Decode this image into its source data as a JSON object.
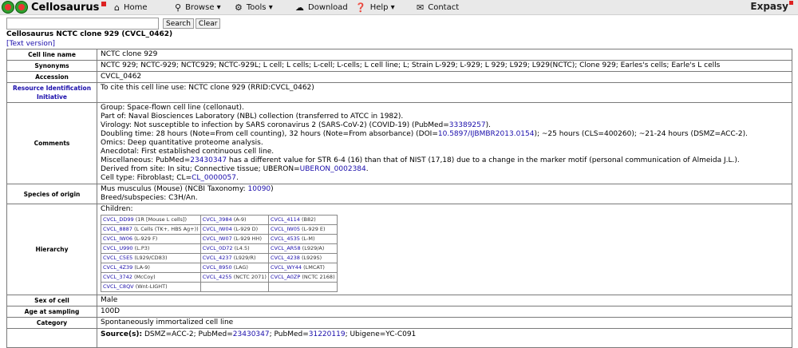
{
  "logo": {
    "name": "Cellosaurus"
  },
  "nav": {
    "home": "Home",
    "browse": "Browse ▾",
    "tools": "Tools ▾",
    "download": "Download",
    "help": "Help ▾",
    "contact": "Contact",
    "expasy": "Expasy"
  },
  "search": {
    "value": "",
    "search_label": "Search",
    "clear_label": "Clear"
  },
  "page_title": "Cellosaurus NCTC clone 929 (CVCL_0462)",
  "text_version": "[Text version]",
  "rows": {
    "cell_line_name": {
      "label": "Cell line name",
      "value": "NCTC clone 929"
    },
    "synonyms": {
      "label": "Synonyms",
      "value": "NCTC 929; NCTC-929; NCTC929; NCTC-929L; L cell; L cells; L-cell; L-cells; L cell line; L; Strain L-929; L-929; L 929; L929; L929(NCTC); Clone 929; Earles's cells; Earle's L cells"
    },
    "accession": {
      "label": "Accession",
      "value": "CVCL_0462"
    },
    "rrid": {
      "label": "Resource Identification Initiative",
      "value": "To cite this cell line use: NCTC clone 929 (RRID:CVCL_0462)"
    },
    "comments": {
      "label": "Comments",
      "group": "Group: Space-flown cell line (cellonaut).",
      "partof": "Part of: Naval Biosciences Laboratory (NBL) collection (transferred to ATCC in 1982).",
      "virology_pre": "Virology: Not susceptible to infection by SARS coronavirus 2 (SARS-CoV-2) (COVID-19) (PubMed=",
      "virology_link": "33389257",
      "virology_post": ").",
      "doubling_pre": "Doubling time: 28 hours (Note=From cell counting), 32 hours (Note=From absorbance) (DOI=",
      "doubling_link": "10.5897/IJBMBR2013.0154",
      "doubling_post": "); ~25 hours (CLS=400260); ~21-24 hours (DSMZ=ACC-2).",
      "omics": "Omics: Deep quantitative proteome analysis.",
      "anecdotal": "Anecdotal: First established continuous cell line.",
      "misc_pre": "Miscellaneous: PubMed=",
      "misc_link": "23430347",
      "misc_post": " has a different value for STR 6-4 (16) than that of NIST (17,18) due to a change in the marker motif (personal communication of Almeida J.L.).",
      "derived_pre": "Derived from site: In situ; Connective tissue; UBERON=",
      "derived_link": "UBERON_0002384",
      "derived_post": ".",
      "celltype_pre": "Cell type: Fibroblast; CL=",
      "celltype_link": "CL_0000057",
      "celltype_post": "."
    },
    "species": {
      "label": "Species of origin",
      "line1_pre": "Mus musculus (Mouse) (NCBI Taxonomy: ",
      "line1_link": "10090",
      "line1_post": ")",
      "line2": "Breed/subspecies: C3H/An."
    },
    "hierarchy": {
      "label": "Hierarchy",
      "children_label": "Children:",
      "children": [
        [
          {
            "id": "CVCL_DD99",
            "desc": "(1R [Mouse L cells])"
          },
          {
            "id": "CVCL_3984",
            "desc": "(A-9)"
          },
          {
            "id": "CVCL_4114",
            "desc": "(B82)"
          }
        ],
        [
          {
            "id": "CVCL_8887",
            "desc": "(L Cells (TK+, HBS Ag+))"
          },
          {
            "id": "CVCL_IW04",
            "desc": "(L-929 D)"
          },
          {
            "id": "CVCL_IW05",
            "desc": "(L-929 E)"
          }
        ],
        [
          {
            "id": "CVCL_IW06",
            "desc": "(L-929 F)"
          },
          {
            "id": "CVCL_IW07",
            "desc": "(L-929 HH)"
          },
          {
            "id": "CVCL_4535",
            "desc": "(L-M)"
          }
        ],
        [
          {
            "id": "CVCL_U990",
            "desc": "(L.P3)"
          },
          {
            "id": "CVCL_0D72",
            "desc": "(L4.5)"
          },
          {
            "id": "CVCL_AR58",
            "desc": "(L929/A)"
          }
        ],
        [
          {
            "id": "CVCL_C5E5",
            "desc": "(L929/CD83)"
          },
          {
            "id": "CVCL_4237",
            "desc": "(L929/R)"
          },
          {
            "id": "CVCL_4238",
            "desc": "(L929S)"
          }
        ],
        [
          {
            "id": "CVCL_4Z39",
            "desc": "(LA-9)"
          },
          {
            "id": "CVCL_8950",
            "desc": "(LAG)"
          },
          {
            "id": "CVCL_WY44",
            "desc": "(LMCAT)"
          }
        ],
        [
          {
            "id": "CVCL_3742",
            "desc": "(McCoy)"
          },
          {
            "id": "CVCL_4255",
            "desc": "(NCTC 2071)"
          },
          {
            "id": "CVCL_A0ZP",
            "desc": "(NCTC 2168)"
          }
        ],
        [
          {
            "id": "CVCL_C8QV",
            "desc": "(Wnt-LIGHT)"
          },
          {
            "id": "",
            "desc": ""
          },
          {
            "id": "",
            "desc": ""
          }
        ]
      ]
    },
    "sex": {
      "label": "Sex of cell",
      "value": "Male"
    },
    "age": {
      "label": "Age at sampling",
      "value": "100D"
    },
    "category": {
      "label": "Category",
      "value": "Spontaneously immortalized cell line"
    },
    "sources": {
      "label_bold": "Source(s):",
      "text_pre": " DSMZ=ACC-2; PubMed=",
      "link1": "23430347",
      "text_mid": "; PubMed=",
      "link2": "31220119",
      "text_post": "; Ubigene=YC-C091"
    }
  }
}
